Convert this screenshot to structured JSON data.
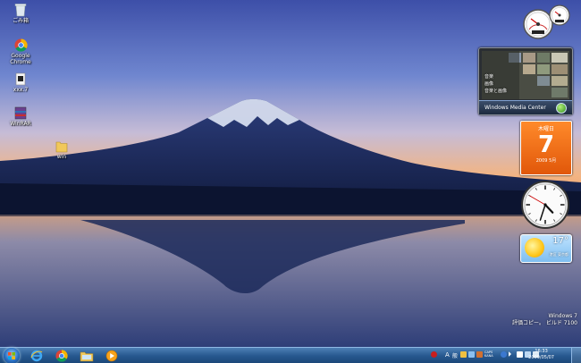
{
  "desktop_icons": [
    {
      "label": "ごみ箱",
      "icon": "recycle-bin-icon"
    },
    {
      "label": "Google Chrome",
      "icon": "chrome-icon"
    },
    {
      "label": "xxx.7",
      "icon": "file-icon"
    },
    {
      "label": "WinRAR",
      "icon": "winrar-icon"
    },
    {
      "label": "win",
      "icon": "folder-icon"
    }
  ],
  "gadgets": {
    "media_center": {
      "items": [
        "音楽",
        "画像",
        "音楽と画像"
      ],
      "title": "Windows Media Center"
    },
    "calendar": {
      "day_of_week": "木曜日",
      "day": "7",
      "month": "2009 5月"
    },
    "clock": {
      "hour": 4,
      "minute": 33,
      "second": 50
    },
    "weather": {
      "temperature": "17°",
      "location": "港区 東京都"
    }
  },
  "watermark": {
    "line1": "Windows 7",
    "line2": "評価コピー。 ビルド 7100"
  },
  "taskbar": {
    "pinned": [
      "start-orb",
      "internet-explorer-icon",
      "chrome-icon",
      "explorer-icon",
      "media-player-icon"
    ],
    "tray": {
      "ime": "A",
      "ime2": "般",
      "caps": "CAPS KANA"
    },
    "clock": {
      "time": "16:33",
      "date": "2009/05/07"
    }
  },
  "colors": {
    "taskbar": "#27588f",
    "calendar": "#e1570a",
    "sky_top": "#5a74c0",
    "sky_horizon": "#f2b483"
  }
}
